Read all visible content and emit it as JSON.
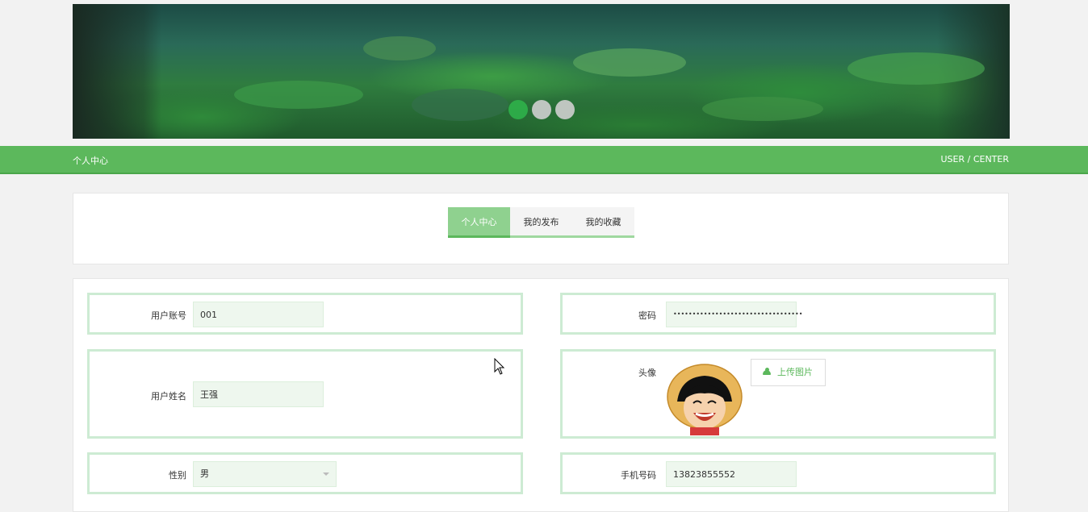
{
  "banner": {
    "slides": 3,
    "active_slide": 1
  },
  "topbar": {
    "left_title": "个人中心",
    "right_title": "USER / CENTER"
  },
  "tabs": [
    {
      "label": "个人中心",
      "active": true
    },
    {
      "label": "我的发布",
      "active": false
    },
    {
      "label": "我的收藏",
      "active": false
    }
  ],
  "form": {
    "account": {
      "label": "用户账号",
      "value": "001"
    },
    "password": {
      "label": "密码",
      "value": "••••••••••••••••••••••••••••••••••"
    },
    "name": {
      "label": "用户姓名",
      "value": "王强"
    },
    "avatar": {
      "label": "头像",
      "upload_label": "上传图片",
      "icon": "cloud-upload-icon"
    },
    "gender": {
      "label": "性别",
      "value": "男"
    },
    "phone": {
      "label": "手机号码",
      "value": "13823855552"
    }
  },
  "colors": {
    "accent": "#5cb85c",
    "tab_active": "#8fd18f",
    "field_border": "#cdebd3",
    "input_bg": "#eef7ee"
  }
}
